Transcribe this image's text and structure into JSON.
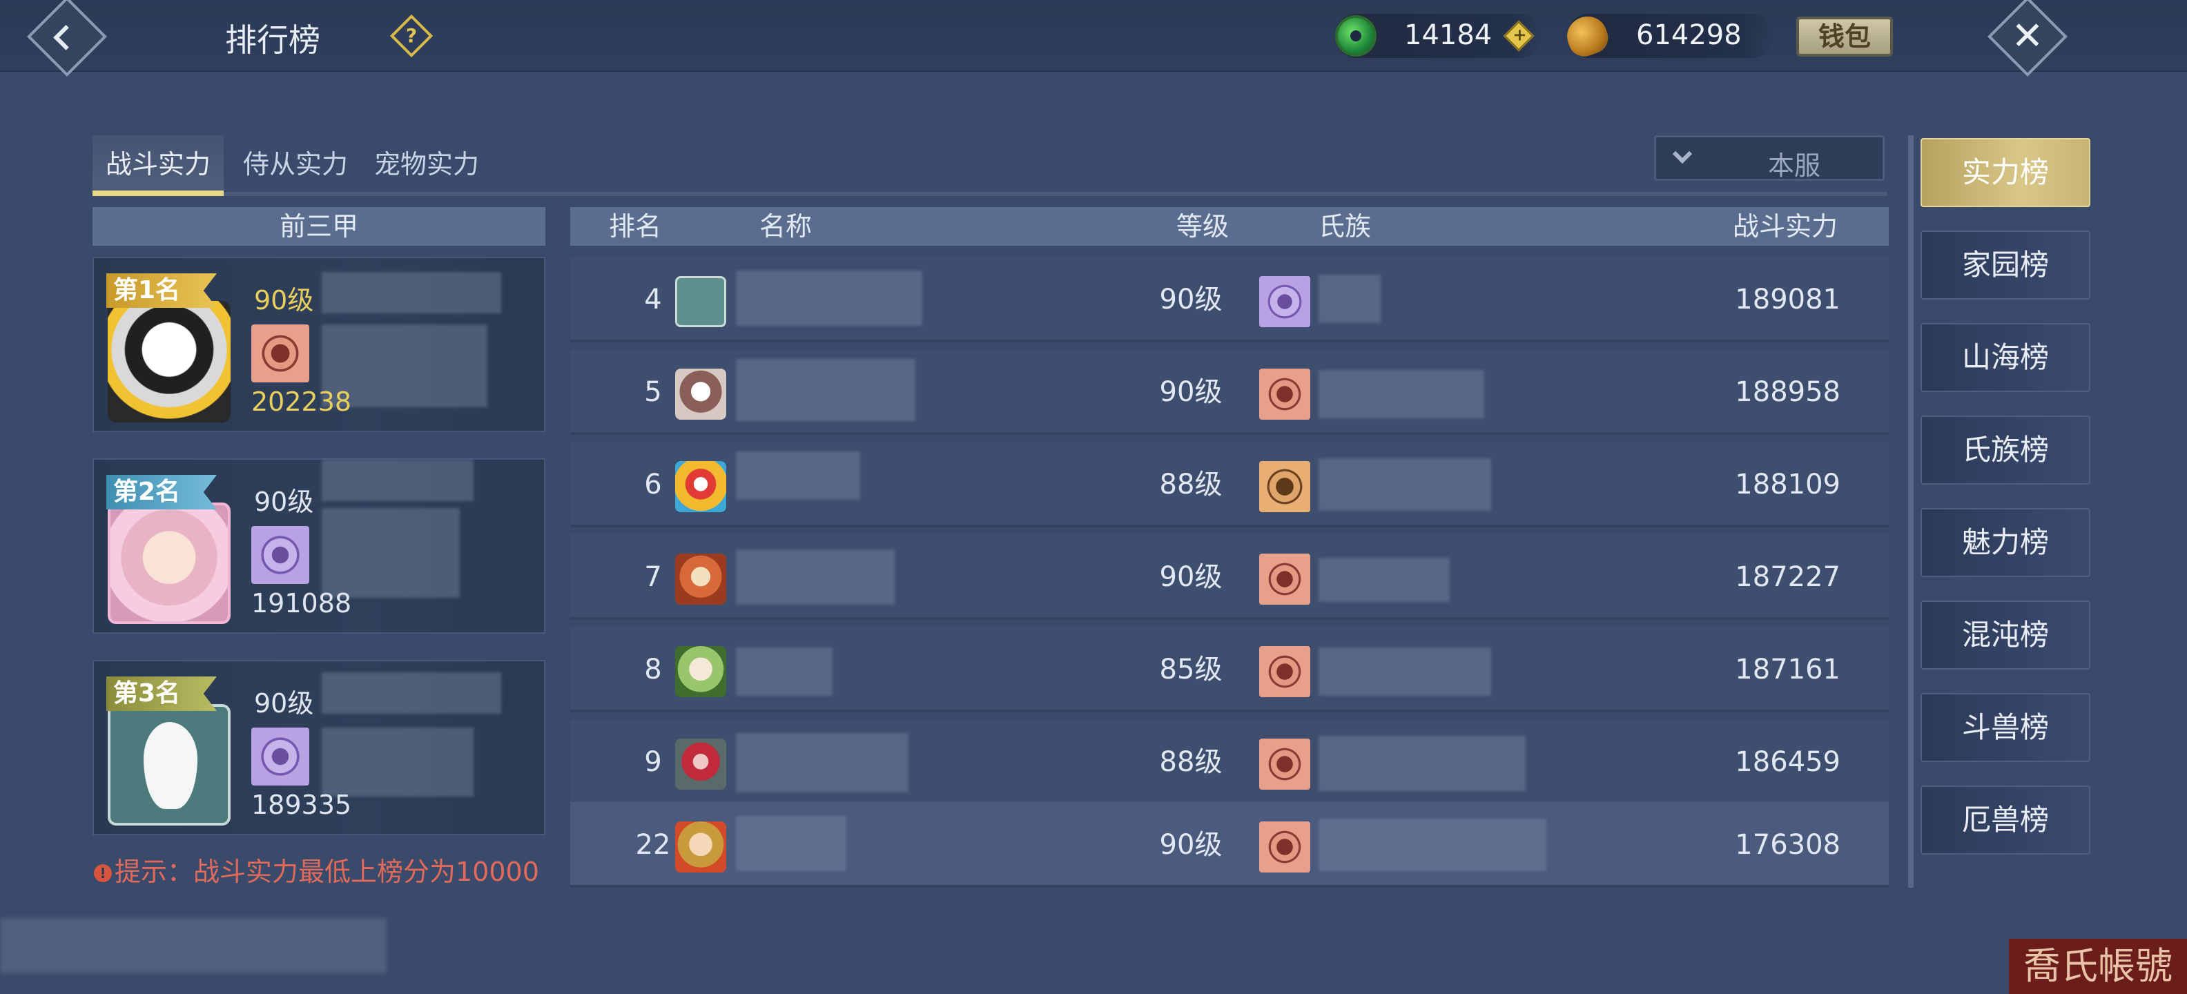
{
  "header": {
    "title": "排行榜",
    "jade": "14184",
    "gold": "614298",
    "wallet_label": "钱包"
  },
  "category_tabs": [
    {
      "label": "战斗实力",
      "active": true
    },
    {
      "label": "侍从实力",
      "active": false
    },
    {
      "label": "宠物实力",
      "active": false
    }
  ],
  "server_filter": "本服",
  "top3": {
    "header": "前三甲",
    "entries": [
      {
        "rank_label": "第1名",
        "level": "90级",
        "power": "202238",
        "clan_icon": "red-clan-emblem-icon"
      },
      {
        "rank_label": "第2名",
        "level": "90级",
        "power": "191088",
        "clan_icon": "purple-clan-emblem-icon"
      },
      {
        "rank_label": "第3名",
        "level": "90级",
        "power": "189335",
        "clan_icon": "purple-clan-emblem-icon"
      }
    ],
    "tip": "提示：战斗实力最低上榜分为10000"
  },
  "table": {
    "columns": [
      "排名",
      "名称",
      "等级",
      "氏族",
      "战斗实力"
    ],
    "rows": [
      {
        "rank": "4",
        "level": "90级",
        "power": "189081",
        "clan_icon": "purple-clan-emblem-icon"
      },
      {
        "rank": "5",
        "level": "90级",
        "power": "188958",
        "clan_icon": "red-clan-emblem-icon"
      },
      {
        "rank": "6",
        "level": "88级",
        "power": "188109",
        "clan_icon": "brown-clan-emblem-icon"
      },
      {
        "rank": "7",
        "level": "90级",
        "power": "187227",
        "clan_icon": "red-clan-emblem-icon"
      },
      {
        "rank": "8",
        "level": "85级",
        "power": "187161",
        "clan_icon": "red-clan-emblem-icon"
      },
      {
        "rank": "9",
        "level": "88级",
        "power": "186459",
        "clan_icon": "red-clan-emblem-icon"
      },
      {
        "rank": "22",
        "level": "90级",
        "power": "176308",
        "clan_icon": "red-clan-emblem-icon",
        "is_self": true
      }
    ]
  },
  "side_tabs": [
    {
      "label": "实力榜",
      "active": true
    },
    {
      "label": "家园榜",
      "active": false
    },
    {
      "label": "山海榜",
      "active": false
    },
    {
      "label": "氏族榜",
      "active": false
    },
    {
      "label": "魅力榜",
      "active": false
    },
    {
      "label": "混沌榜",
      "active": false
    },
    {
      "label": "斗兽榜",
      "active": false
    },
    {
      "label": "厄兽榜",
      "active": false
    }
  ],
  "watermark": "喬氏帳號",
  "colors": {
    "background": "#3a4a6a",
    "accent_gold": "#e9d78a",
    "level_gold": "#e8cf5c",
    "tip_red": "#e26a5a"
  }
}
